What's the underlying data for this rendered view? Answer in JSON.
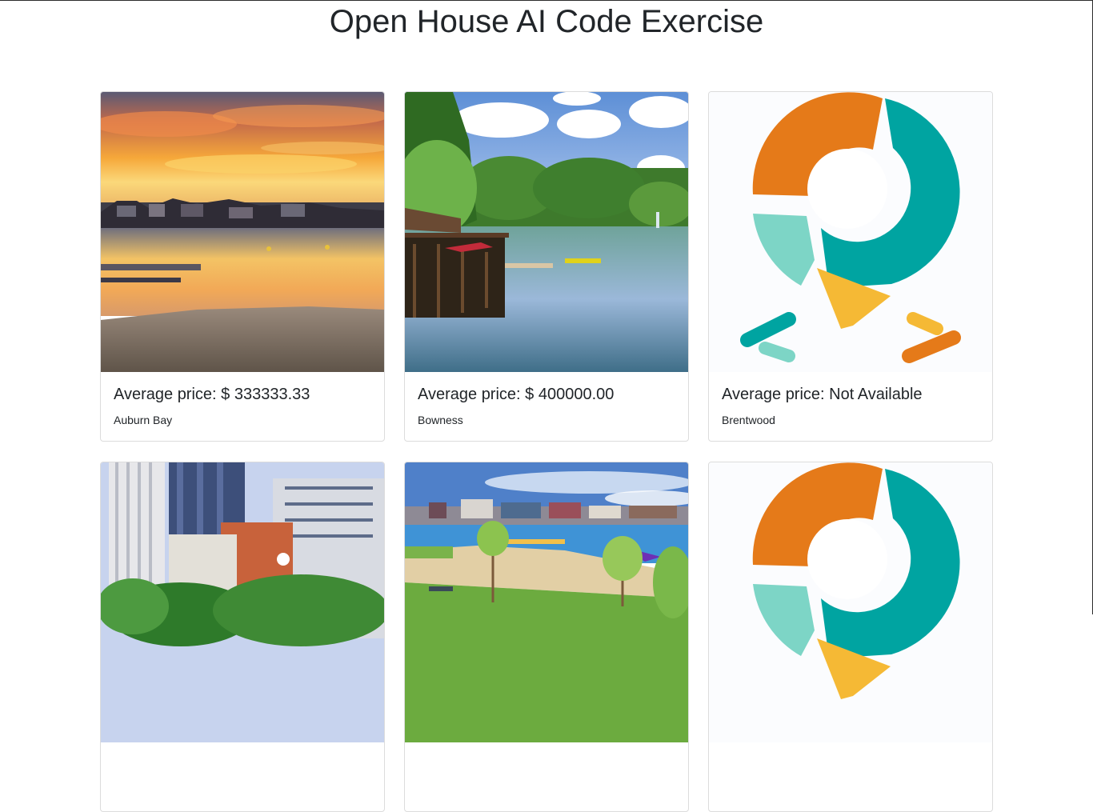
{
  "page": {
    "title": "Open House AI Code Exercise"
  },
  "cards": [
    {
      "image": "lake-sunset-photo",
      "price_prefix": "Average price: ",
      "price_value": "$ 333333.33",
      "community": "Auburn Bay"
    },
    {
      "image": "lake-park-photo",
      "price_prefix": "Average price: ",
      "price_value": "$ 400000.00",
      "community": "Bowness"
    },
    {
      "image": "open-house-ai-logo",
      "price_prefix": "Average price: ",
      "price_value": "Not Available",
      "community": "Brentwood"
    },
    {
      "image": "downtown-city-photo"
    },
    {
      "image": "lake-beach-photo"
    },
    {
      "image": "open-house-ai-logo"
    }
  ],
  "colors": {
    "logo_orange": "#e57a19",
    "logo_teal": "#00a4a1",
    "logo_mint": "#7dd5c6",
    "logo_yellow": "#f5b935"
  }
}
